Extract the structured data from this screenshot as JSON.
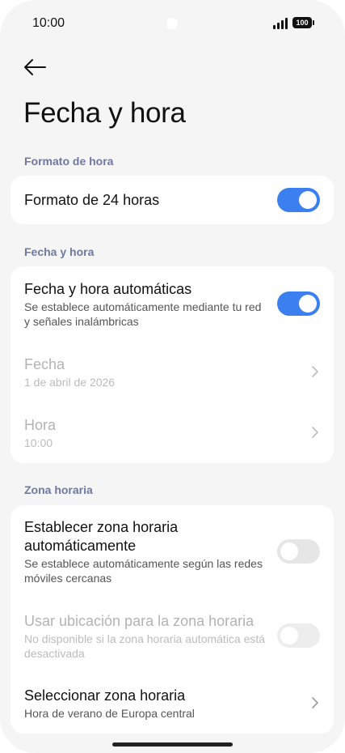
{
  "status": {
    "time": "10:00",
    "battery": "100"
  },
  "page": {
    "title": "Fecha y hora"
  },
  "sections": {
    "time_format": {
      "label": "Formato de hora",
      "row_24h": {
        "title": "Formato de 24 horas",
        "toggle": "on"
      }
    },
    "date_time": {
      "label": "Fecha y hora",
      "auto": {
        "title": "Fecha y hora automáticas",
        "subtitle": "Se establece automáticamente mediante tu red y señales inalámbricas",
        "toggle": "on"
      },
      "date": {
        "title": "Fecha",
        "value": "1 de abril de 2026"
      },
      "time": {
        "title": "Hora",
        "value": "10:00"
      }
    },
    "time_zone": {
      "label": "Zona horaria",
      "auto_zone": {
        "title": "Establecer zona horaria automáticamente",
        "subtitle": "Se establece automáticamente según las redes móviles cercanas",
        "toggle": "off"
      },
      "use_location": {
        "title": "Usar ubicación para la zona horaria",
        "subtitle": "No disponible si la zona horaria automática está desactivada",
        "toggle": "off-disabled"
      },
      "select_zone": {
        "title": "Seleccionar zona horaria",
        "value": "Hora de verano de Europa central"
      }
    }
  },
  "colors": {
    "accent": "#3b7ff0",
    "section_label": "#6f78a3",
    "background": "#f5f5f5"
  }
}
